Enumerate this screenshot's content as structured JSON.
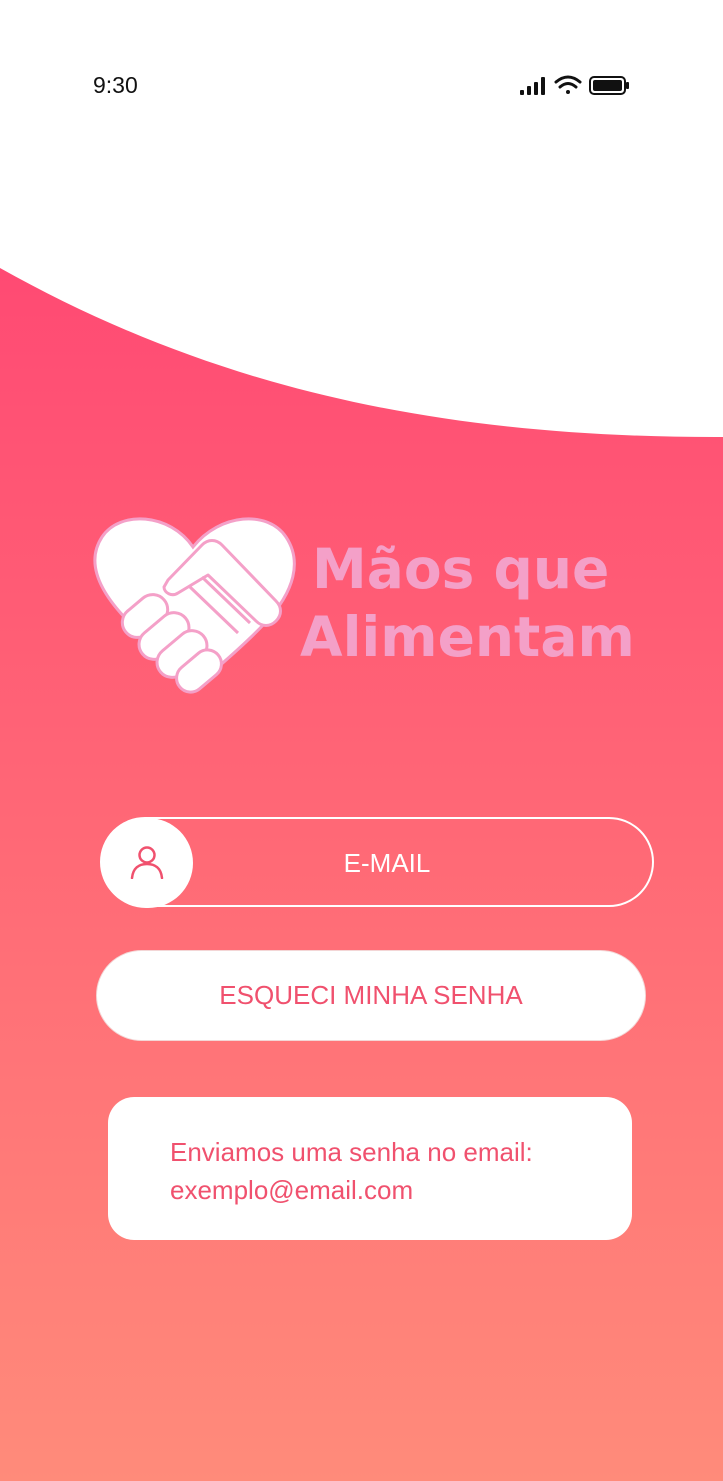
{
  "status_bar": {
    "time": "9:30"
  },
  "brand": {
    "line1": "Mãos que",
    "line2": "Alimentam"
  },
  "email_field": {
    "label": "E-MAIL"
  },
  "forgot_button": {
    "label": "ESQUECI MINHA SENHA"
  },
  "message": {
    "line1": "Enviamos uma senha no email:",
    "line2": "exemplo@email.com"
  },
  "colors": {
    "gradient_top": "#ff4d72",
    "gradient_bottom": "#ff8a7a",
    "accent_text": "#f0516e",
    "brand_text": "#f4a0c8"
  },
  "icons": [
    "signal-icon",
    "wifi-icon",
    "battery-icon",
    "heart-handshake-icon",
    "user-icon"
  ]
}
